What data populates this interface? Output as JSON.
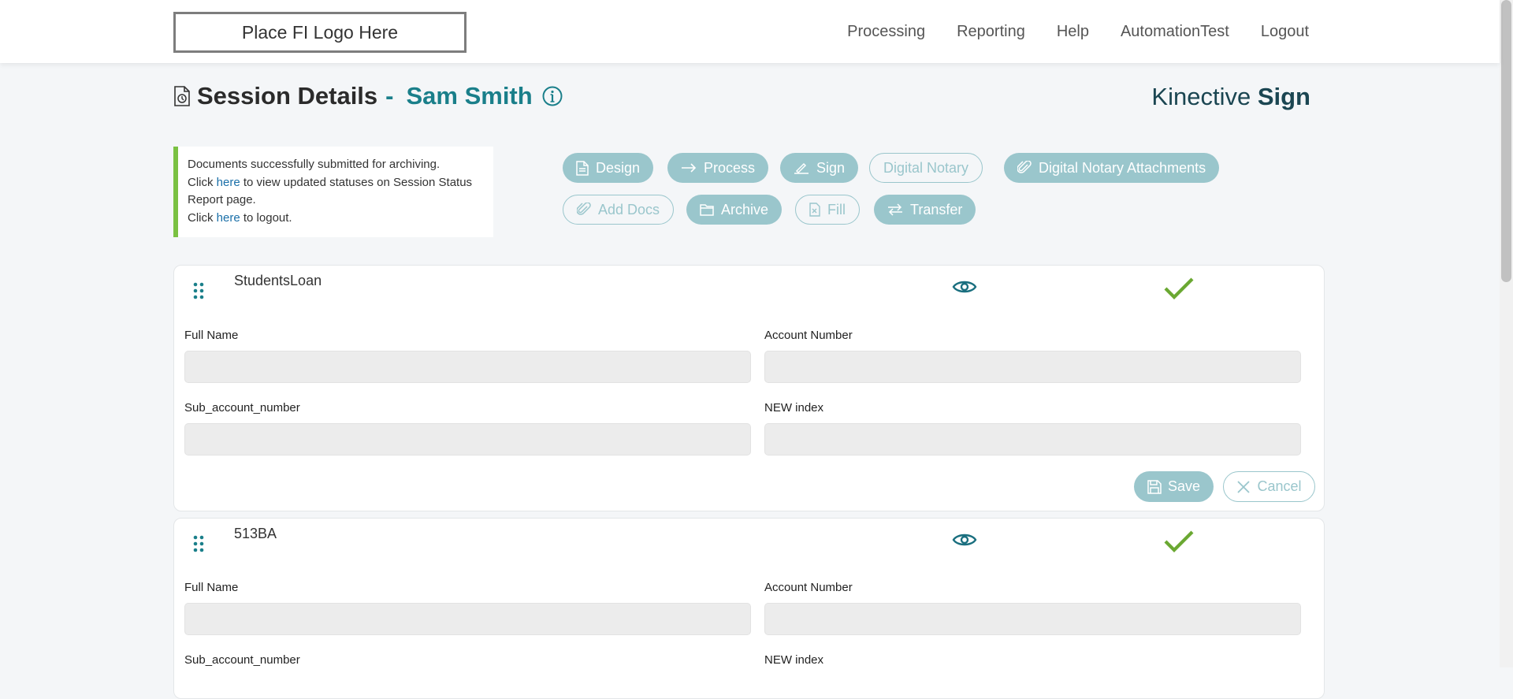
{
  "header": {
    "logo_text": "Place FI Logo Here",
    "nav": [
      "Processing",
      "Reporting",
      "Help",
      "AutomationTest",
      "Logout"
    ]
  },
  "page": {
    "title": "Session Details",
    "separator": "-",
    "user_name": "Sam Smith",
    "brand_light": "Kinective",
    "brand_bold": "Sign"
  },
  "notice": {
    "line1": "Documents successfully submitted for archiving.",
    "line2_pre": "Click",
    "line2_link": "here",
    "line2_post": "to view updated statuses on Session Status Report page.",
    "line3_pre": "Click",
    "line3_link": "here",
    "line3_post": "to logout."
  },
  "actions": {
    "design": "Design",
    "process": "Process",
    "sign": "Sign",
    "digital_notary": "Digital Notary",
    "digital_notary_attachments": "Digital Notary Attachments",
    "add_docs": "Add Docs",
    "archive": "Archive",
    "fill": "Fill",
    "transfer": "Transfer"
  },
  "documents": [
    {
      "name": "StudentsLoan",
      "fields": [
        "Full Name",
        "Account Number",
        "Sub_account_number",
        "NEW index"
      ],
      "save_label": "Save",
      "cancel_label": "Cancel"
    },
    {
      "name": "513BA",
      "fields": [
        "Full Name",
        "Account Number",
        "Sub_account_number",
        "NEW index"
      ]
    }
  ],
  "colors": {
    "accent": "#1a7f8a",
    "button_fill": "#9ac6cc",
    "success_check": "#6aa832",
    "notice_border": "#7ac142"
  },
  "icons": {
    "drag": "drag-handle-icon",
    "view": "eye-icon",
    "status": "checkmark-icon"
  }
}
